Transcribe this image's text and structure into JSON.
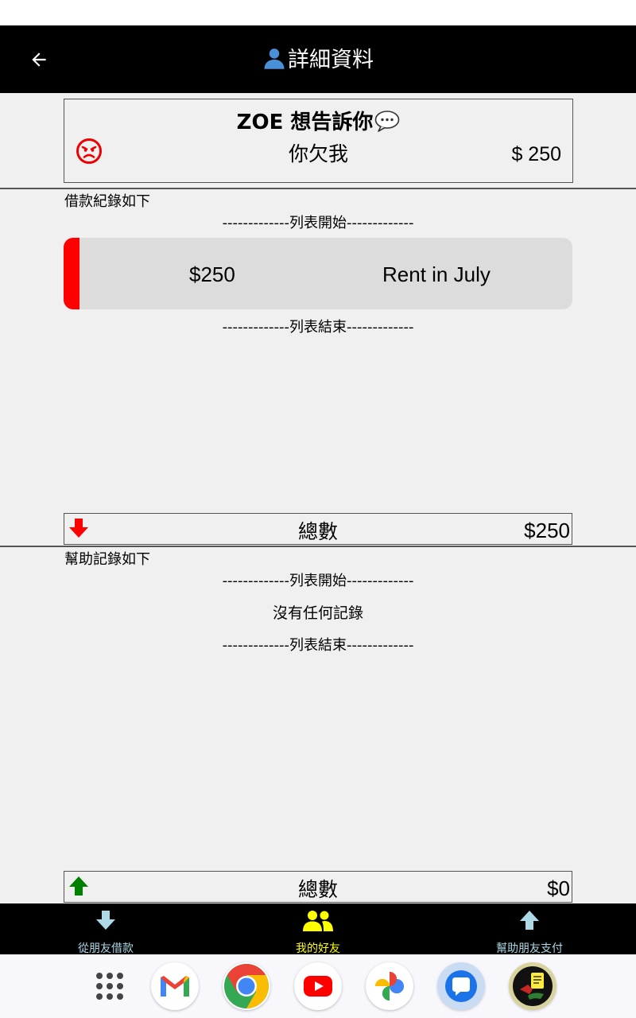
{
  "header": {
    "back_icon": "arrow-left-icon",
    "title": "詳細資料",
    "title_icon": "person-icon"
  },
  "message": {
    "title": "ZOE 想告訴你",
    "title_icon": "speech-bubble-icon",
    "mood_icon": "angry-face-icon",
    "status_text": "你欠我",
    "amount": "$ 250"
  },
  "borrow": {
    "section_label": "借款紀錄如下",
    "list_start": "-------------列表開始-------------",
    "list_end": "-------------列表結束-------------",
    "records": [
      {
        "amount": "$250",
        "note": "Rent in July",
        "accent": "#ff0000"
      }
    ],
    "total_label": "總數",
    "total_value": "$250",
    "total_icon": "arrow-down-red-icon"
  },
  "help": {
    "section_label": "幫助記錄如下",
    "list_start": "-------------列表開始-------------",
    "empty_text": "沒有任何記錄",
    "list_end": "-------------列表結束-------------",
    "total_label": "總數",
    "total_value": "$0",
    "total_icon": "arrow-up-green-icon"
  },
  "bottom_nav": {
    "items": [
      {
        "label": "從朋友借款",
        "icon": "arrow-down-icon",
        "color": "#add8e6"
      },
      {
        "label": "我的好友",
        "icon": "people-icon",
        "color": "#ffff00",
        "active": true
      },
      {
        "label": "幫助朋友支付",
        "icon": "arrow-up-icon",
        "color": "#add8e6"
      }
    ]
  },
  "dock": {
    "apps": [
      "app-drawer-icon",
      "gmail-icon",
      "chrome-icon",
      "youtube-icon",
      "photos-icon",
      "messages-icon",
      "app-icon"
    ]
  },
  "colors": {
    "appbar": "#000000",
    "accent_red": "#ff0000",
    "accent_green": "#008000",
    "nav_active": "#ffff00",
    "nav_inactive": "#add8e6"
  }
}
